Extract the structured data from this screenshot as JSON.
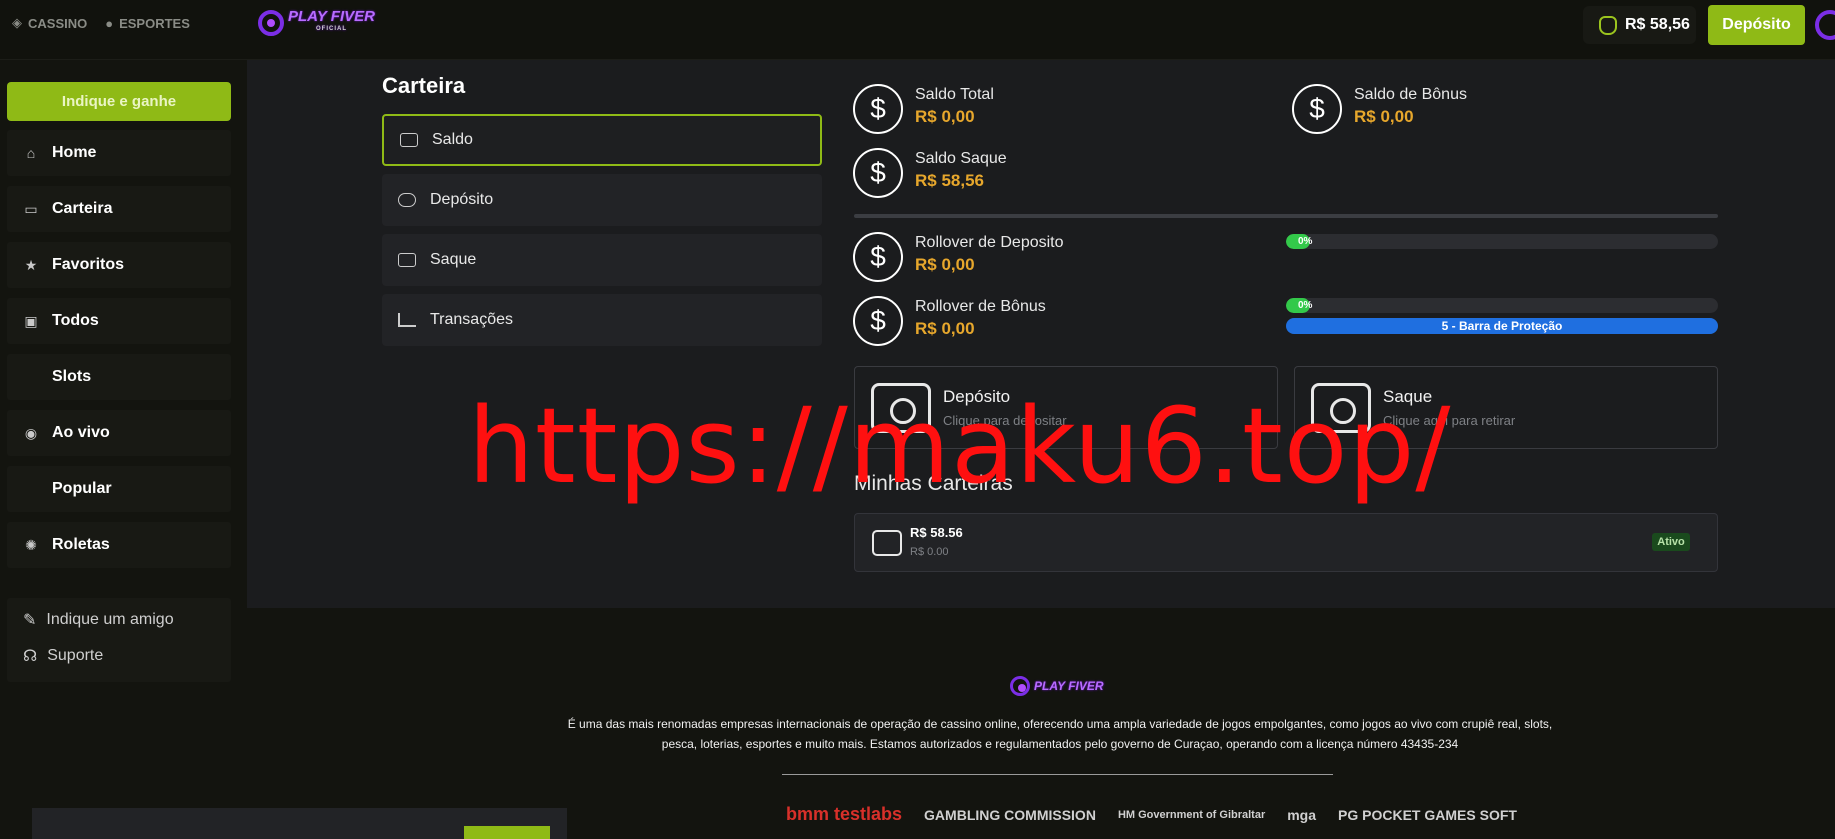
{
  "topbar": {
    "nav": [
      {
        "label": "CASSINO",
        "icon": "casino-icon"
      },
      {
        "label": "ESPORTES",
        "icon": "sports-icon"
      }
    ],
    "logo": {
      "text": "PLAY FIVER",
      "sub": "OFICIAL"
    },
    "balance": "R$ 58,56",
    "deposit_label": "Depósito"
  },
  "sidebar": {
    "promo_label": "Indique e ganhe",
    "items": [
      {
        "label": "Home",
        "icon": "home-icon"
      },
      {
        "label": "Carteira",
        "icon": "wallet-icon"
      },
      {
        "label": "Favoritos",
        "icon": "star-icon"
      },
      {
        "label": "Todos",
        "icon": "slot-machine-icon"
      },
      {
        "label": "Slots",
        "icon": ""
      },
      {
        "label": "Ao vivo",
        "icon": "live-icon"
      },
      {
        "label": "Popular",
        "icon": ""
      },
      {
        "label": "Roletas",
        "icon": "roulette-icon"
      }
    ],
    "extra": [
      {
        "label": "Indique um amigo",
        "icon": "megaphone-icon"
      },
      {
        "label": "Suporte",
        "icon": "headset-icon"
      }
    ]
  },
  "wallet": {
    "title": "Carteira",
    "menu": [
      {
        "label": "Saldo",
        "icon": "wallet-icon",
        "active": true
      },
      {
        "label": "Depósito",
        "icon": "piggy-bank-icon"
      },
      {
        "label": "Saque",
        "icon": "cash-icon"
      },
      {
        "label": "Transações",
        "icon": "chart-icon"
      }
    ],
    "stats": {
      "saldo_total": {
        "label": "Saldo Total",
        "value": "R$ 0,00"
      },
      "saldo_bonus": {
        "label": "Saldo de Bônus",
        "value": "R$ 0,00"
      },
      "saldo_saque": {
        "label": "Saldo Saque",
        "value": "R$ 58,56"
      },
      "rollover_deposito": {
        "label": "Rollover de Deposito",
        "value": "R$ 0,00",
        "progress": "0%"
      },
      "rollover_bonus": {
        "label": "Rollover de Bônus",
        "value": "R$ 0,00",
        "progress": "0%"
      }
    },
    "protection_bar": "5 - Barra de Proteção",
    "cards": [
      {
        "title": "Depósito",
        "subtitle": "Clique para depositar"
      },
      {
        "title": "Saque",
        "subtitle": "Clique aqui para retirar"
      }
    ],
    "minhas_title": "Minhas Carteiras",
    "wallet_row": {
      "amount": "R$ 58.56",
      "bonus": "R$ 0.00",
      "status": "Ativo"
    }
  },
  "watermark": "https://maku6.top/",
  "footer": {
    "logo": "PLAY FIVER",
    "text": "É uma das mais renomadas empresas internacionais de operação de cassino online, oferecendo uma ampla variedade de jogos empolgantes, como jogos ao vivo com crupiê real, slots, pesca, loterias, esportes e muito mais. Estamos autorizados e regulamentados pelo governo de Curaçao, operando com a licença número 43435-234",
    "partners": [
      "bmm testlabs",
      "GAMBLING COMMISSION",
      "HM Government of Gibraltar",
      "mga",
      "PG POCKET GAMES SOFT"
    ]
  },
  "colors": {
    "accent": "#8fba16",
    "money": "#e7a72c",
    "protection": "#1f6fe0",
    "progress": "#33c94a"
  }
}
